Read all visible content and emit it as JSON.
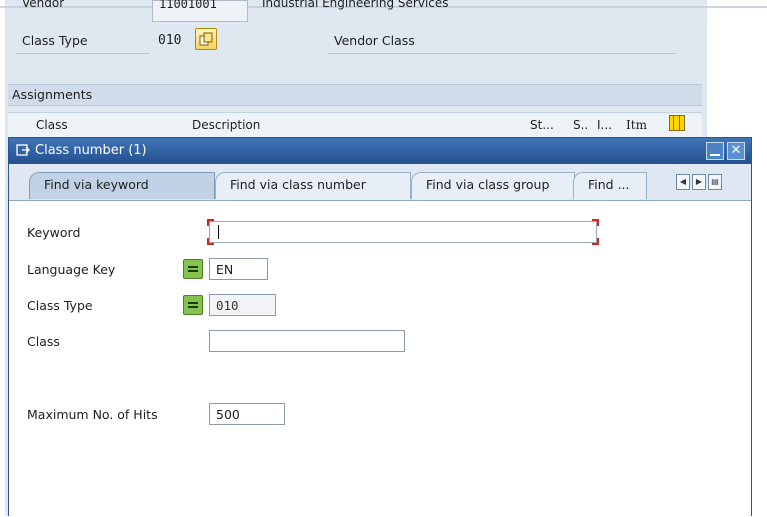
{
  "background": {
    "vendor_label": "Vendor",
    "vendor_value": "11001001",
    "vendor_name": "Industrial Engineering Services",
    "class_type_label": "Class Type",
    "class_type_value": "010",
    "class_type_desc": "Vendor Class",
    "assignments_title": "Assignments",
    "columns": [
      "Class",
      "Description",
      "St...",
      "S..",
      "I...",
      "Itm"
    ]
  },
  "dialog": {
    "title": "Class number (1)",
    "tabs": [
      {
        "label": "Find via keyword",
        "active": true
      },
      {
        "label": "Find via class number",
        "active": false
      },
      {
        "label": "Find via class group",
        "active": false
      },
      {
        "label": "Find ...",
        "active": false
      }
    ],
    "fields": {
      "keyword": {
        "label": "Keyword",
        "value": ""
      },
      "language_key": {
        "label": "Language Key",
        "value": "EN"
      },
      "class_type": {
        "label": "Class Type",
        "value": "010"
      },
      "class": {
        "label": "Class",
        "value": ""
      },
      "max_hits": {
        "label": "Maximum No. of Hits",
        "value": "500"
      }
    }
  },
  "colors": {
    "titlebar": "#2d5e9f",
    "match_button": "#84c44e",
    "focus_marker": "#d0281c"
  }
}
